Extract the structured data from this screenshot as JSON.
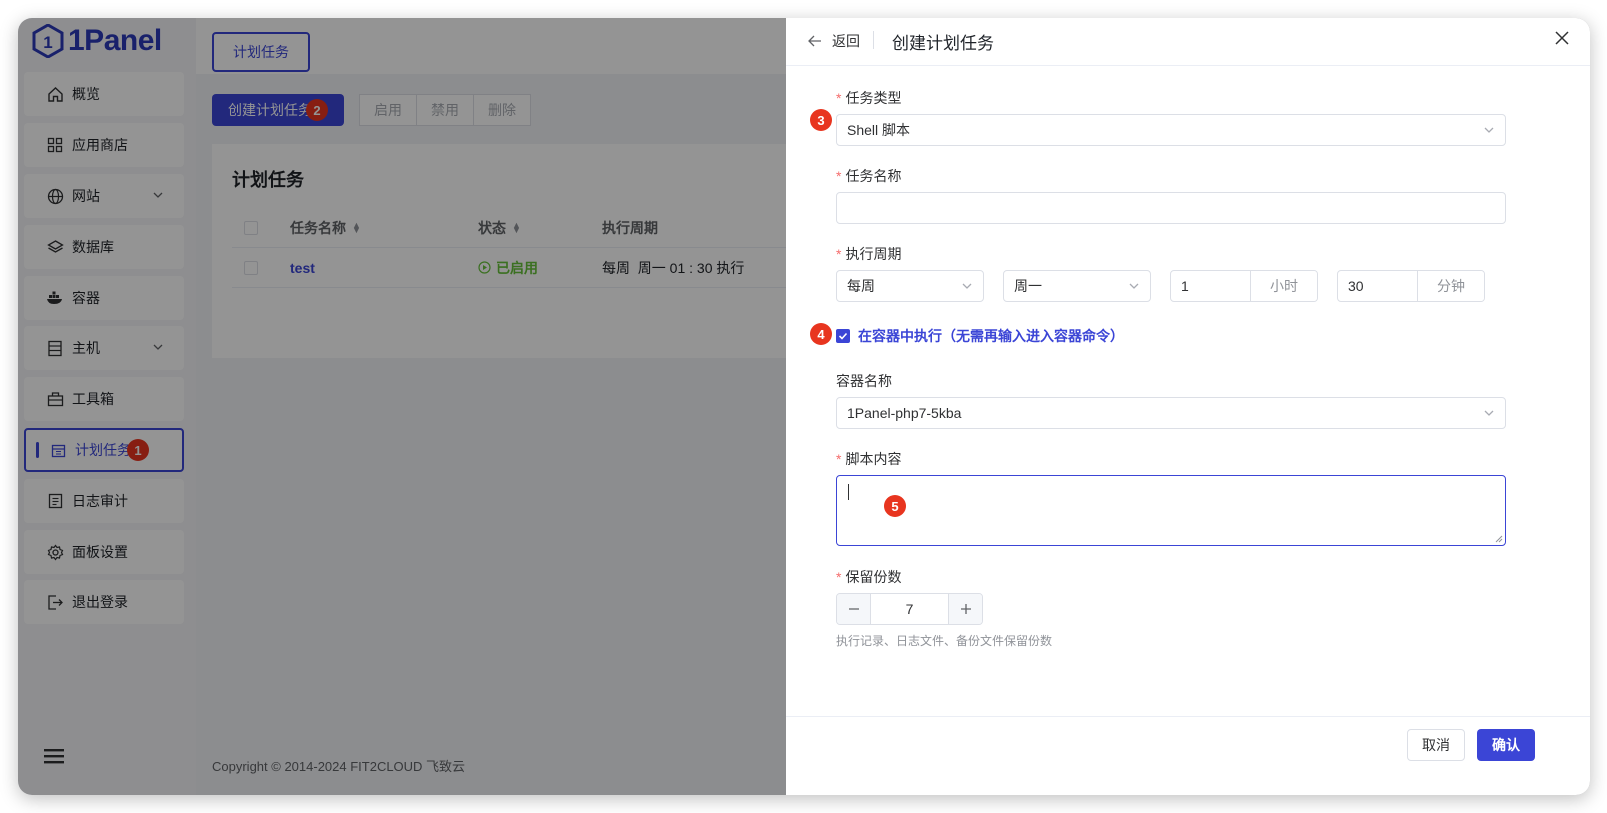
{
  "app": {
    "logo_text": "1Panel"
  },
  "sidebar": {
    "items": [
      {
        "label": "概览",
        "icon": "home-icon"
      },
      {
        "label": "应用商店",
        "icon": "grid-icon"
      },
      {
        "label": "网站",
        "icon": "globe-icon",
        "has_children": true
      },
      {
        "label": "数据库",
        "icon": "layers-icon"
      },
      {
        "label": "容器",
        "icon": "docker-icon"
      },
      {
        "label": "主机",
        "icon": "server-icon",
        "has_children": true
      },
      {
        "label": "工具箱",
        "icon": "toolbox-icon"
      },
      {
        "label": "计划任务",
        "icon": "calendar-icon",
        "active": true
      },
      {
        "label": "日志审计",
        "icon": "log-icon"
      },
      {
        "label": "面板设置",
        "icon": "gear-icon"
      },
      {
        "label": "退出登录",
        "icon": "logout-icon"
      }
    ]
  },
  "main": {
    "tab_label": "计划任务",
    "toolbar": {
      "create_label": "创建计划任务",
      "enable_label": "启用",
      "disable_label": "禁用",
      "delete_label": "删除"
    },
    "card_title": "计划任务",
    "table": {
      "headers": [
        "任务名称",
        "状态",
        "执行周期"
      ],
      "rows": [
        {
          "name": "test",
          "status": "已启用",
          "cycle": "每周  周一 01 : 30 执行"
        }
      ]
    },
    "footer": "Copyright © 2014-2024 FIT2CLOUD 飞致云"
  },
  "drawer": {
    "back_label": "返回",
    "title": "创建计划任务",
    "task_type_label": "任务类型",
    "task_type_value": "Shell 脚本",
    "task_name_label": "任务名称",
    "task_name_value": "",
    "cycle_label": "执行周期",
    "cycle_type": "每周",
    "cycle_weekday": "周一",
    "cycle_hour": "1",
    "cycle_hour_unit": "小时",
    "cycle_minute": "30",
    "cycle_minute_unit": "分钟",
    "in_container_label": "在容器中执行（无需再输入进入容器命令）",
    "in_container_checked": true,
    "container_name_label": "容器名称",
    "container_name_value": "1Panel-php7-5kba",
    "script_label": "脚本内容",
    "script_value": "",
    "retain_label": "保留份数",
    "retain_value": "7",
    "retain_hint": "执行记录、日志文件、备份文件保留份数",
    "cancel_label": "取消",
    "confirm_label": "确认"
  },
  "annotations": [
    "1",
    "2",
    "3",
    "4",
    "5"
  ],
  "colors": {
    "primary": "#3b45d6",
    "badge": "#e8351f",
    "success": "#67c23a"
  }
}
